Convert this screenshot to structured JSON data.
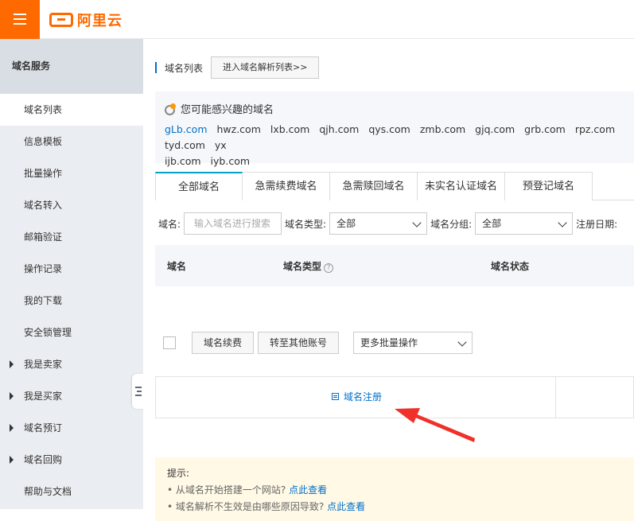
{
  "header": {
    "logo_text": "阿里云"
  },
  "sidebar": {
    "section_title": "域名服务",
    "items": [
      {
        "label": "域名列表"
      },
      {
        "label": "信息模板"
      },
      {
        "label": "批量操作"
      },
      {
        "label": "域名转入"
      },
      {
        "label": "邮箱验证"
      },
      {
        "label": "操作记录"
      },
      {
        "label": "我的下载"
      },
      {
        "label": "安全锁管理"
      },
      {
        "label": "我是卖家"
      },
      {
        "label": "我是买家"
      },
      {
        "label": "域名预订"
      },
      {
        "label": "域名回购"
      },
      {
        "label": "帮助与文档"
      }
    ]
  },
  "breadcrumb": {
    "title": "域名列表",
    "resolve_button": "进入域名解析列表>>"
  },
  "suggest": {
    "title": "您可能感兴趣的域名",
    "domains": [
      "gLb.com",
      "hwz.com",
      "lxb.com",
      "qjh.com",
      "qys.com",
      "zmb.com",
      "gjq.com",
      "grb.com",
      "rpz.com",
      "tyd.com",
      "yx",
      "ijb.com",
      "iyb.com"
    ]
  },
  "tabs": [
    "全部域名",
    "急需续费域名",
    "急需赎回域名",
    "未实名认证域名",
    "预登记域名"
  ],
  "filters": {
    "domain_label": "域名:",
    "domain_placeholder": "输入域名进行搜索",
    "type_label": "域名类型:",
    "type_value": "全部",
    "group_label": "域名分组:",
    "group_value": "全部",
    "date_label": "注册日期:"
  },
  "table": {
    "col_domain": "域名",
    "col_type": "域名类型",
    "col_status": "域名状态"
  },
  "batch": {
    "renew": "域名续费",
    "transfer": "转至其他账号",
    "more": "更多批量操作"
  },
  "register": {
    "label": "域名注册"
  },
  "tips": {
    "title": "提示:",
    "line1": "• 从域名开始搭建一个网站?",
    "line1_link": "点此查看",
    "line2": "• 域名解析不生效是由哪些原因导致?",
    "line2_link": "点此查看"
  },
  "colors": {
    "accent": "#ff6a00",
    "link": "#0070cc",
    "arrow": "#f0302a"
  }
}
